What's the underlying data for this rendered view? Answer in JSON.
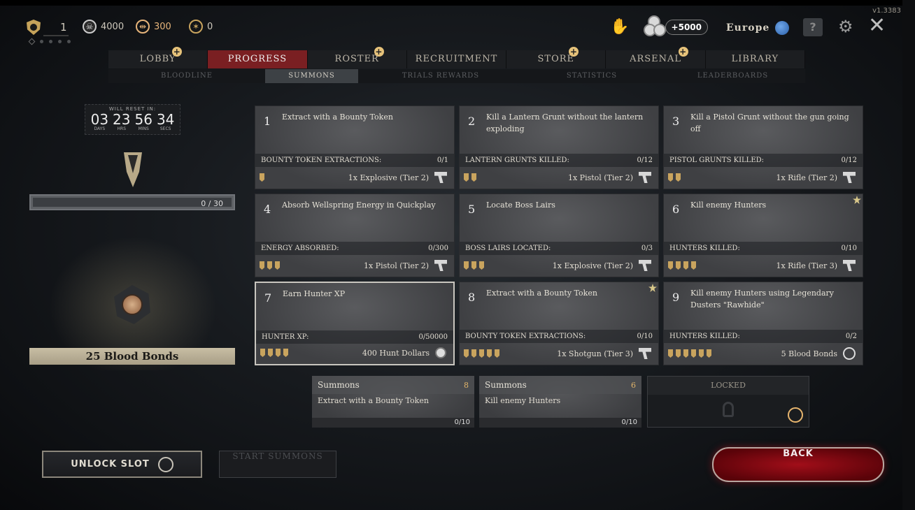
{
  "version": "v1.3383",
  "topbar": {
    "level": "1",
    "hunt_dollars": "4000",
    "blood_bonds": "300",
    "event_points": "0",
    "bonus": "+5000",
    "region": "Europe"
  },
  "nav": {
    "tabs": [
      "LOBBY",
      "PROGRESS",
      "ROSTER",
      "RECRUITMENT",
      "STORE",
      "ARSENAL",
      "LIBRARY"
    ],
    "active": "PROGRESS"
  },
  "subnav": {
    "tabs": [
      "BLOODLINE",
      "SUMMONS",
      "TRIALS REWARDS",
      "STATISTICS",
      "LEADERBOARDS"
    ],
    "active": "SUMMONS"
  },
  "left": {
    "timer_label": "WILL RESET IN:",
    "timer": {
      "days": "03",
      "hrs": "23",
      "mins": "56",
      "secs": "34",
      "days_l": "DAYS",
      "hrs_l": "HRS",
      "mins_l": "MINS",
      "secs_l": "SECS"
    },
    "progress_text": "0 / 30",
    "bonds_label": "25 Blood Bonds"
  },
  "cards": [
    {
      "num": "1",
      "task": "Extract with a Bounty Token",
      "stat_label": "BOUNTY TOKEN EXTRACTIONS:",
      "stat": "0/1",
      "marks": 1,
      "reward": "1x Explosive (Tier 2)",
      "reward_icon": "revolver-icon",
      "starred": false,
      "highlight": false
    },
    {
      "num": "2",
      "task": "Kill a Lantern Grunt without the lantern exploding",
      "stat_label": "LANTERN GRUNTS KILLED:",
      "stat": "0/12",
      "marks": 2,
      "reward": "1x Pistol (Tier 2)",
      "reward_icon": "revolver-icon",
      "starred": false,
      "highlight": false
    },
    {
      "num": "3",
      "task": "Kill a Pistol Grunt without the gun going off",
      "stat_label": "PISTOL GRUNTS KILLED:",
      "stat": "0/12",
      "marks": 2,
      "reward": "1x Rifle (Tier 2)",
      "reward_icon": "revolver-icon",
      "starred": false,
      "highlight": false
    },
    {
      "num": "4",
      "task": "Absorb Wellspring Energy in Quickplay",
      "stat_label": "ENERGY ABSORBED:",
      "stat": "0/300",
      "marks": 3,
      "reward": "1x Pistol (Tier 2)",
      "reward_icon": "revolver-icon",
      "starred": false,
      "highlight": false
    },
    {
      "num": "5",
      "task": "Locate Boss Lairs",
      "stat_label": "BOSS LAIRS LOCATED:",
      "stat": "0/3",
      "marks": 3,
      "reward": "1x Explosive (Tier 2)",
      "reward_icon": "revolver-icon",
      "starred": false,
      "highlight": false
    },
    {
      "num": "6",
      "task": "Kill enemy Hunters",
      "stat_label": "HUNTERS KILLED:",
      "stat": "0/10",
      "marks": 4,
      "reward": "1x Rifle (Tier 3)",
      "reward_icon": "revolver-icon",
      "starred": true,
      "highlight": false
    },
    {
      "num": "7",
      "task": "Earn Hunter XP",
      "stat_label": "HUNTER XP:",
      "stat": "0/50000",
      "marks": 4,
      "reward": "400 Hunt Dollars",
      "reward_icon": "hunt-dollar-icon",
      "starred": false,
      "highlight": true
    },
    {
      "num": "8",
      "task": "Extract with a Bounty Token",
      "stat_label": "BOUNTY TOKEN EXTRACTIONS:",
      "stat": "0/10",
      "marks": 5,
      "reward": "1x Shotgun (Tier 3)",
      "reward_icon": "revolver-icon",
      "starred": true,
      "highlight": false
    },
    {
      "num": "9",
      "task": "Kill enemy Hunters using Legendary Dusters \"Rawhide\"",
      "stat_label": "HUNTERS KILLED:",
      "stat": "0/2",
      "marks": 6,
      "reward": "5 Blood Bonds",
      "reward_icon": "blood-bond-icon",
      "starred": false,
      "highlight": false
    }
  ],
  "summons": [
    {
      "title": "Summons",
      "count": "8",
      "task": "Extract with a Bounty Token",
      "progress": "0/10"
    },
    {
      "title": "Summons",
      "count": "6",
      "task": "Kill enemy Hunters",
      "progress": "0/10"
    }
  ],
  "locked_label": "LOCKED",
  "buttons": {
    "unlock": "UNLOCK SLOT",
    "start": "START SUMMONS",
    "back": "BACK"
  },
  "colors": {
    "accent_red": "#7a1f22",
    "gold": "#c9a45e",
    "back_red": "#a10e19"
  }
}
